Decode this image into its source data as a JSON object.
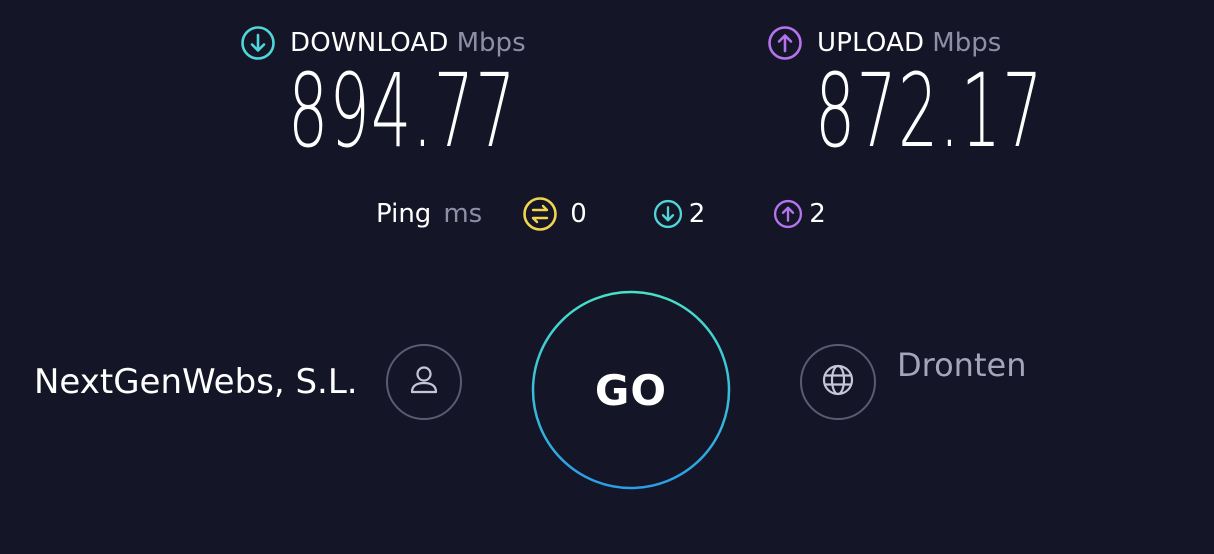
{
  "download": {
    "label": "DOWNLOAD",
    "unit": "Mbps",
    "value": "894.77",
    "icon": "arrow-down-circle-icon",
    "color": "#4fd6d9"
  },
  "upload": {
    "label": "UPLOAD",
    "unit": "Mbps",
    "value": "872.17",
    "icon": "arrow-up-circle-icon",
    "color": "#b574ee"
  },
  "ping": {
    "label": "Ping",
    "unit": "ms",
    "idle": {
      "value": "0",
      "icon": "idle-latency-icon",
      "color": "#f0d44f"
    },
    "download": {
      "value": "2",
      "icon": "arrow-down-circle-icon",
      "color": "#4fd6d9"
    },
    "upload": {
      "value": "2",
      "icon": "arrow-up-circle-icon",
      "color": "#b574ee"
    }
  },
  "provider": {
    "name": "NextGenWebs, S.L.",
    "icon": "user-icon"
  },
  "server": {
    "name": "Dronten",
    "icon": "globe-icon"
  },
  "go_button": {
    "label": "GO",
    "ring_color_start": "#48e0c8",
    "ring_color_end": "#2a9ee6"
  }
}
